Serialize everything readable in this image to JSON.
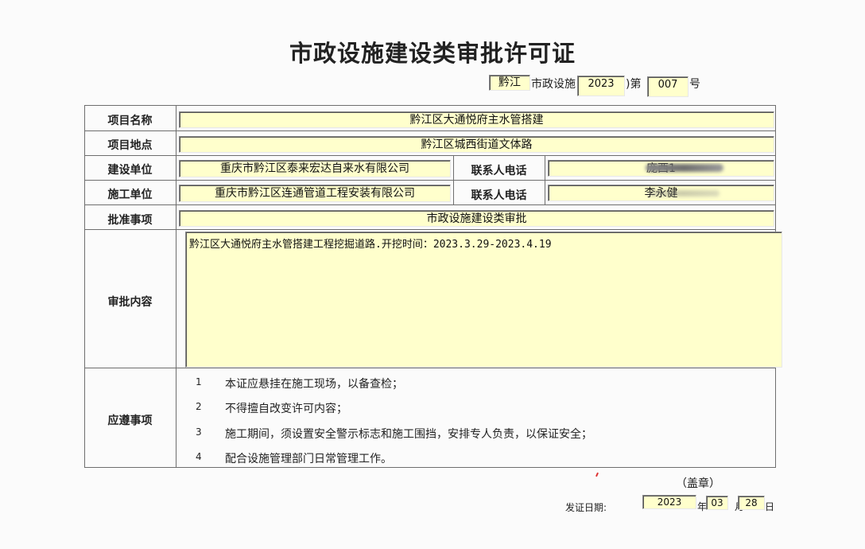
{
  "document": {
    "title": "市政设施建设类审批许可证"
  },
  "number_line": {
    "region": "黔江",
    "middle_text": "市政设施",
    "year": "2023",
    "paren_text": ")第",
    "serial": "007",
    "suffix": "号"
  },
  "table": {
    "project_name": {
      "label": "项目名称",
      "value": "黔江区大通悦府主水管搭建"
    },
    "project_location": {
      "label": "项目地点",
      "value": "黔江区城西街道文体路"
    },
    "builder": {
      "label": "建设单位",
      "value": "重庆市黔江区泰来宏达自来水有限公司",
      "contact_label": "联系人电话",
      "contact_value": "庞西1"
    },
    "constructor": {
      "label": "施工单位",
      "value": "重庆市黔江区连通管道工程安装有限公司",
      "contact_label": "联系人电话",
      "contact_value": "李永健"
    },
    "approval_item": {
      "label": "批准事项",
      "value": "市政设施建设类审批"
    },
    "approval_content": {
      "label": "审批内容",
      "value": "黔江区大通悦府主水管搭建工程挖掘道路.开挖时间：2023.3.29-2023.4.19"
    },
    "notices": {
      "label": "应遵事项",
      "items": [
        {
          "num": "1",
          "text": "本证应悬挂在施工现场，以备查检；"
        },
        {
          "num": "2",
          "text": "不得擅自改变许可内容；"
        },
        {
          "num": "3",
          "text": "施工期间，须设置安全警示标志和施工围挡，安排专人负责，以保证安全；"
        },
        {
          "num": "4",
          "text": "配合设施管理部门日常管理工作。"
        }
      ]
    }
  },
  "footer": {
    "seal": "（盖章）",
    "issue_label": "发证日期:",
    "year": "2023",
    "year_unit": "年",
    "month": "03",
    "month_unit": "月",
    "day": "28",
    "day_unit": "日"
  },
  "colors": {
    "field_fill": "#ffffcc",
    "table_line": "#6e6e6e",
    "redaction": "#7a7a7a"
  }
}
